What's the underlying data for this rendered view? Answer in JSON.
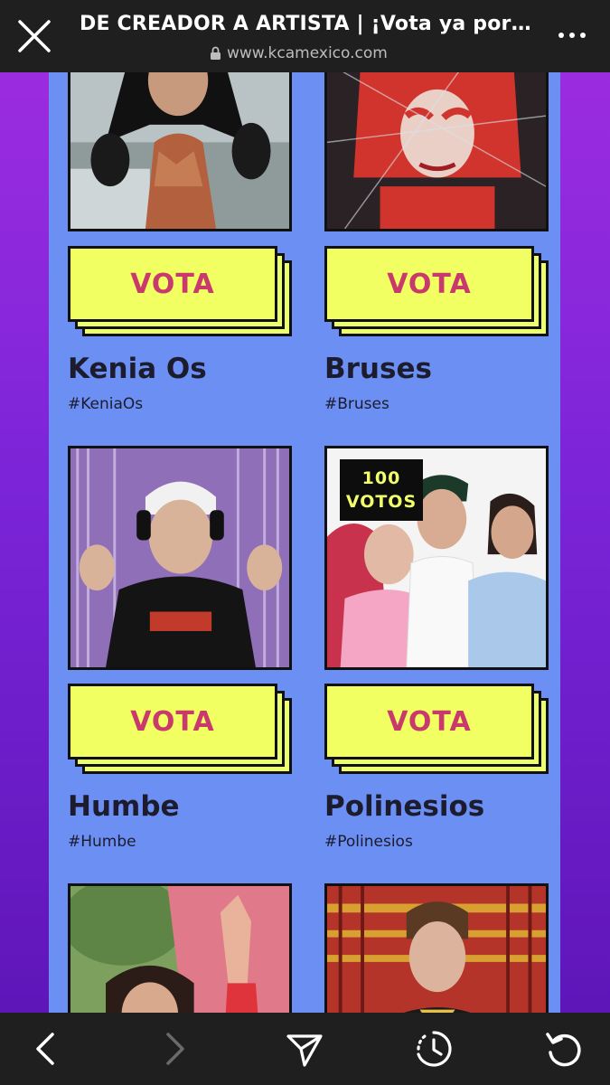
{
  "header": {
    "title": "DE CREADOR A ARTISTA | ¡Vota ya por t...",
    "url": "www.kcamexico.com",
    "close_icon": "close-icon",
    "lock_icon": "lock-icon",
    "more_icon": "more-dots-icon"
  },
  "vote_label": "VOTA",
  "cards": [
    {
      "name": "Kenia Os",
      "tag": "#KeniaOs"
    },
    {
      "name": "Bruses",
      "tag": "#Bruses"
    },
    {
      "name": "Humbe",
      "tag": "#Humbe"
    },
    {
      "name": "Polinesios",
      "tag": "#Polinesios",
      "badge": {
        "count": "100",
        "unit": "VOTOS"
      }
    }
  ],
  "toolbar": {
    "back_icon": "chevron-left-icon",
    "forward_icon": "chevron-right-icon",
    "share_icon": "send-icon",
    "history_icon": "history-icon",
    "reload_icon": "reload-icon"
  },
  "colors": {
    "panel": "#6b8ff2",
    "vote_button": "#f2ff62",
    "vote_text": "#c93a6c",
    "bar": "#1f1f1f"
  }
}
